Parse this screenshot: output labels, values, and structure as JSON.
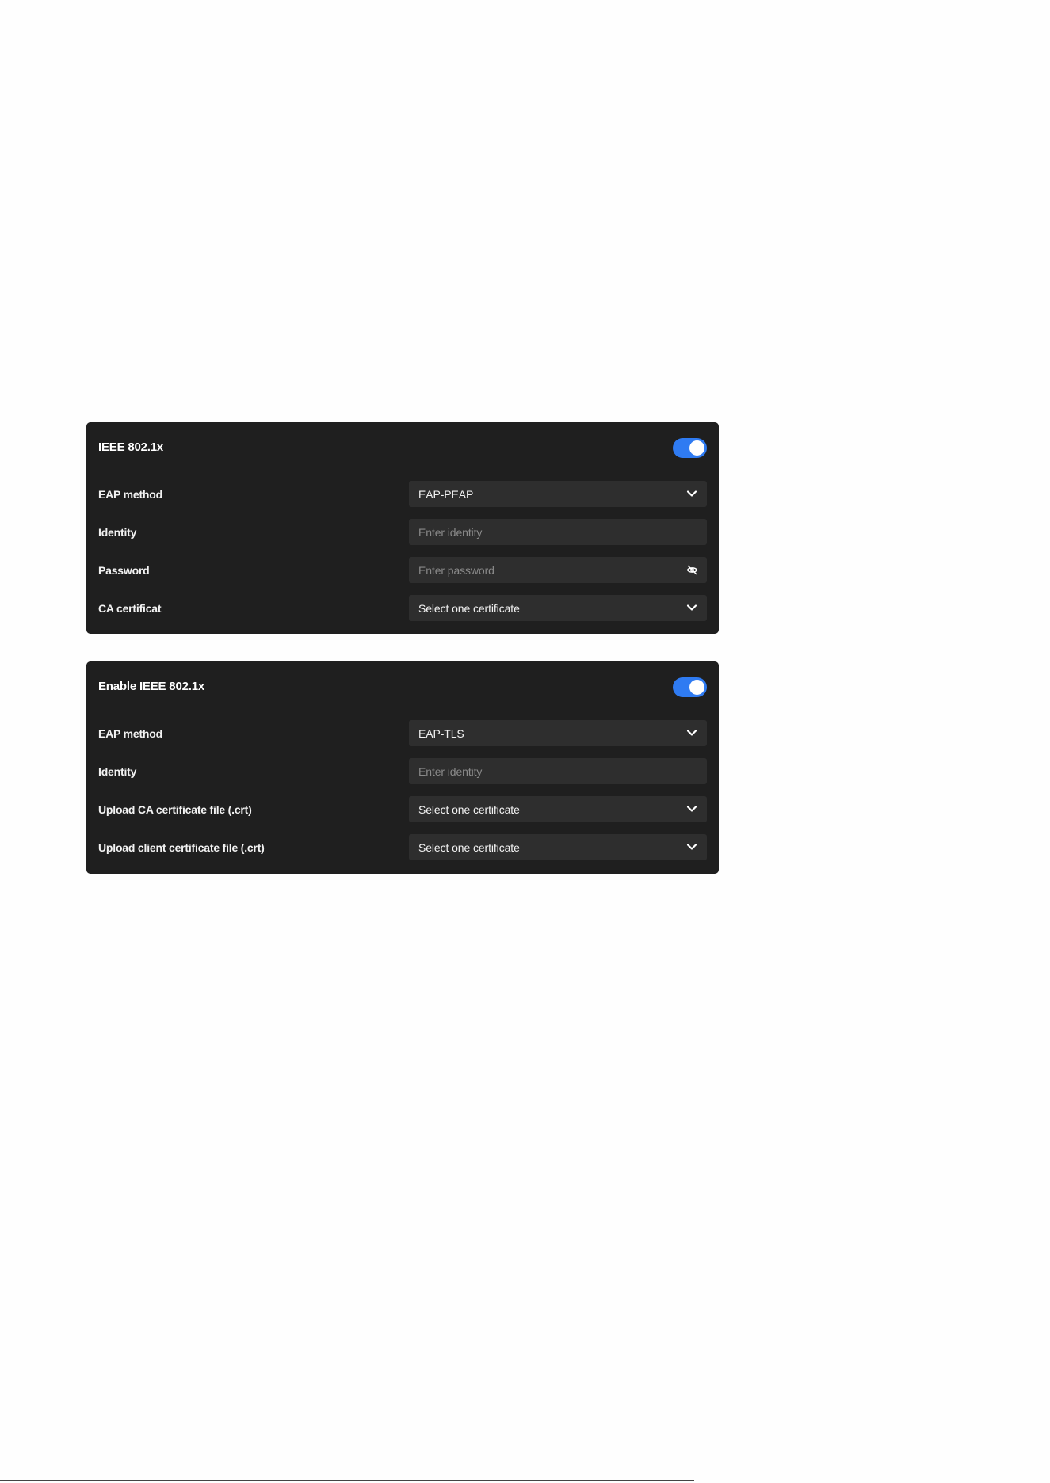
{
  "panels": [
    {
      "title": "IEEE 802.1x",
      "toggle_on": true,
      "rows": {
        "eap_method": {
          "label": "EAP method",
          "value": "EAP-PEAP"
        },
        "identity": {
          "label": "Identity",
          "placeholder": "Enter identity"
        },
        "password": {
          "label": "Password",
          "placeholder": "Enter password"
        },
        "ca_certificate": {
          "label": "CA certificat",
          "value": "Select one certificate"
        }
      }
    },
    {
      "title": "Enable IEEE 802.1x",
      "toggle_on": true,
      "rows": {
        "eap_method": {
          "label": "EAP method",
          "value": "EAP-TLS"
        },
        "identity": {
          "label": "Identity",
          "placeholder": "Enter identity"
        },
        "upload_ca": {
          "label": "Upload CA certificate file (.crt)",
          "value": "Select one certificate"
        },
        "upload_client": {
          "label": "Upload client certificate file (.crt)",
          "value": "Select one certificate"
        }
      }
    }
  ],
  "colors": {
    "page_background": "#fefefe",
    "panel_background": "#1f1f1f",
    "field_background": "#2e2e2e",
    "toggle_accent": "#2f7bf2",
    "placeholder_text": "#8a8a8a"
  },
  "icons": {
    "dropdown": "chevron-down-icon",
    "password_visibility": "eye-slash-icon"
  }
}
